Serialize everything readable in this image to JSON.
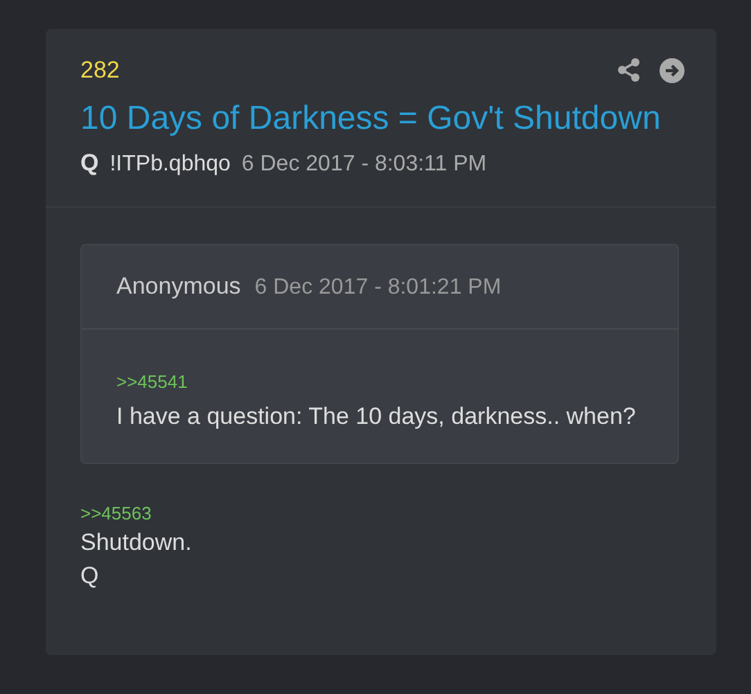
{
  "post": {
    "number": "282",
    "title": "10 Days of Darkness = Gov't Shutdown",
    "author": "Q",
    "tripcode": "!ITPb.qbhqo",
    "time": "6 Dec 2017 - 8:03:11 PM"
  },
  "quote": {
    "author": "Anonymous",
    "time": "6 Dec 2017 - 8:01:21 PM",
    "reference": ">>45541",
    "text": "I have a question: The 10 days, darkness.. when?"
  },
  "reply": {
    "reference": ">>45563",
    "lines": [
      "Shutdown.",
      "Q"
    ]
  }
}
